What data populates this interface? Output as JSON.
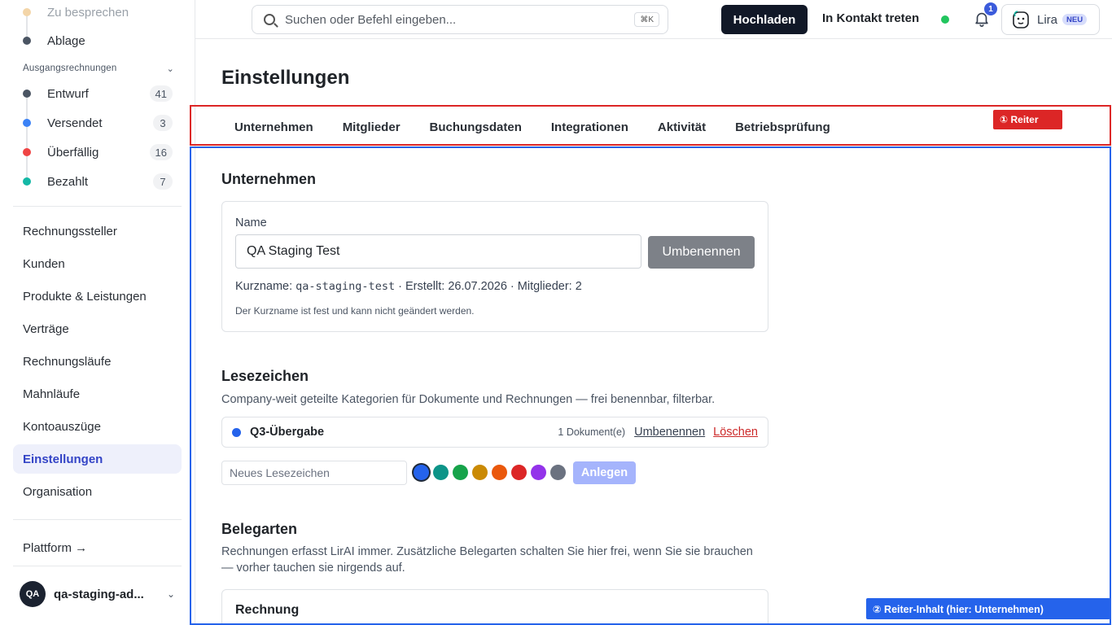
{
  "sidebar": {
    "top_items": [
      {
        "label": "Zu besprechen",
        "color": "#f3d5a8"
      },
      {
        "label": "Ablage",
        "color": "#4b5563"
      }
    ],
    "group_header": "Ausgangsrechnungen",
    "statuses": [
      {
        "label": "Entwurf",
        "count": "41",
        "color": "#4b5563"
      },
      {
        "label": "Versendet",
        "count": "3",
        "color": "#3b82f6"
      },
      {
        "label": "Überfällig",
        "count": "16",
        "color": "#ef4444"
      },
      {
        "label": "Bezahlt",
        "count": "7",
        "color": "#14b8a6"
      }
    ],
    "nav": [
      "Rechnungssteller",
      "Kunden",
      "Produkte & Leistungen",
      "Verträge",
      "Rechnungsläufe",
      "Mahnläufe",
      "Kontoauszüge",
      "Einstellungen",
      "Organisation"
    ],
    "active_nav": "Einstellungen",
    "platform_link": "Plattform →",
    "org": {
      "initials": "QA",
      "name": "qa-staging-ad..."
    }
  },
  "topbar": {
    "search_placeholder": "Suchen oder Befehl eingeben...",
    "search_shortcut": "⌘K",
    "upload_label": "Hochladen",
    "contact_label": "In Kontakt treten",
    "notification_count": "1",
    "assistant_name": "Lira",
    "assistant_badge": "NEU"
  },
  "main": {
    "title": "Einstellungen",
    "tabs": [
      "Unternehmen",
      "Mitglieder",
      "Buchungsdaten",
      "Integrationen",
      "Aktivität",
      "Betriebsprüfung"
    ],
    "company": {
      "heading": "Unternehmen",
      "name_label": "Name",
      "name_value": "QA Staging Test",
      "rename_label": "Umbenennen",
      "meta_prefix": "Kurzname: ",
      "slug": "qa-staging-test",
      "meta_suffix": " · Erstellt: 26.07.2026 · Mitglieder: 2",
      "hint": "Der Kurzname ist fest und kann nicht geändert werden."
    },
    "bookmarks": {
      "heading": "Lesezeichen",
      "description": "Company-weit geteilte Kategorien für Dokumente und Rechnungen — frei benennbar, filterbar.",
      "items": [
        {
          "name": "Q3-Übergabe",
          "count": "1 Dokument(e)",
          "rename": "Umbenennen",
          "delete": "Löschen",
          "color": "#2563eb"
        }
      ],
      "new_placeholder": "Neues Lesezeichen",
      "swatches": [
        "#2563eb",
        "#0d9488",
        "#16a34a",
        "#ca8a04",
        "#ea580c",
        "#dc2626",
        "#9333ea",
        "#6b7280"
      ],
      "add_label": "Anlegen"
    },
    "doc_types": {
      "heading": "Belegarten",
      "description": "Rechnungen erfasst LirAI immer. Zusätzliche Belegarten schalten Sie hier frei, wenn Sie sie brauchen — vorher tauchen sie nirgends auf.",
      "first_card_title": "Rechnung"
    }
  },
  "annotations": {
    "tabs_tag": "① Reiter",
    "content_tag": "② Reiter-Inhalt (hier: Unternehmen)"
  }
}
